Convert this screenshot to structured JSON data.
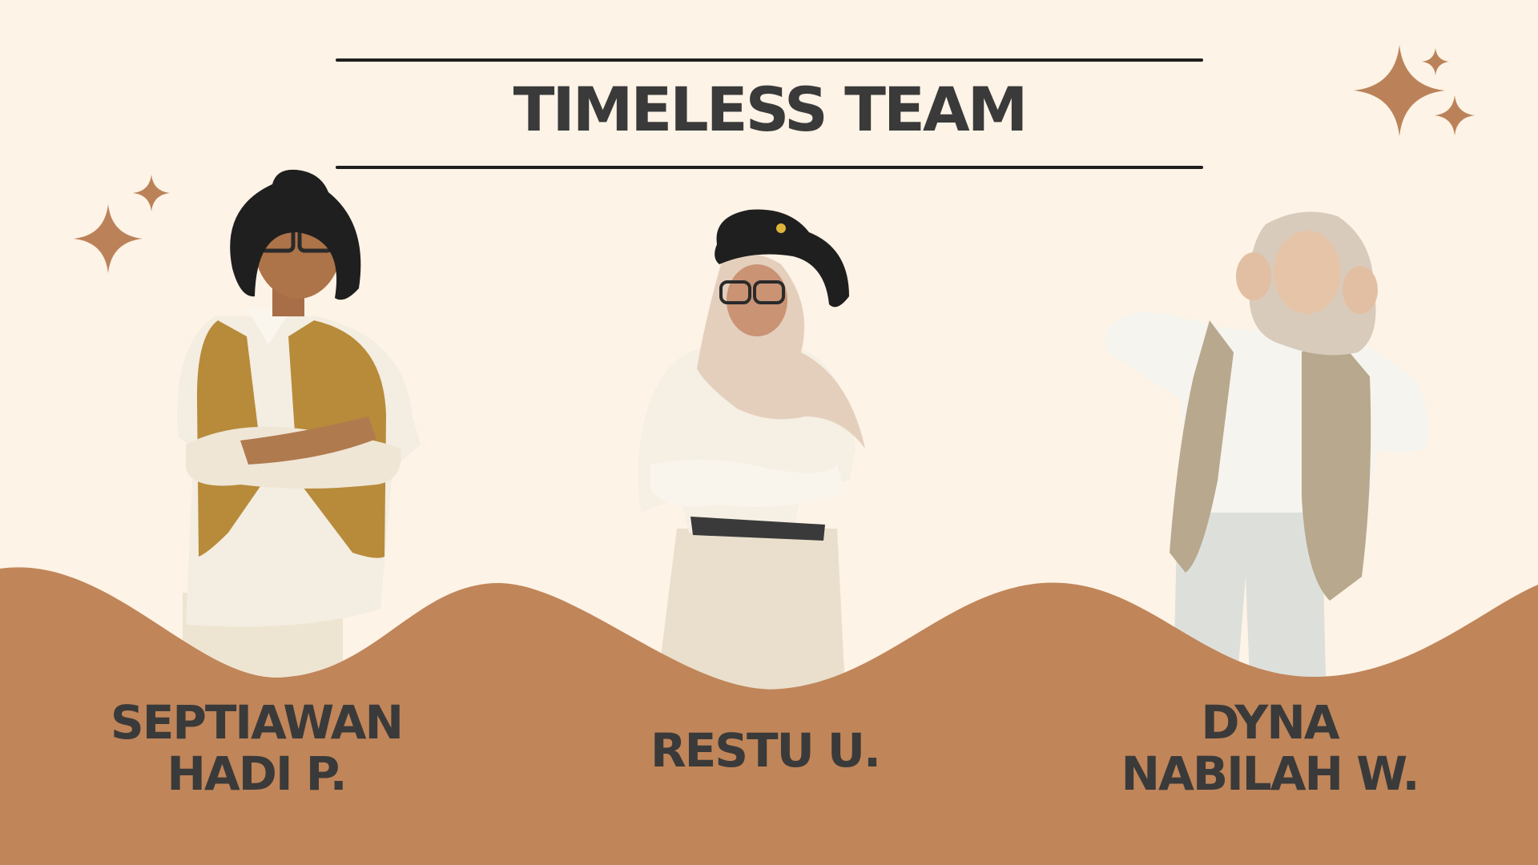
{
  "title": "TIMELESS TEAM",
  "colors": {
    "background": "#fdf3e6",
    "wave": "#c08559",
    "sparkle": "#bb8259",
    "text": "#3a3a3a",
    "rule": "#1f1f1f"
  },
  "members": [
    {
      "name_line1": "SEPTIAWAN",
      "name_line2": "HADI P."
    },
    {
      "name_line1": "RESTU U.",
      "name_line2": ""
    },
    {
      "name_line1": "DYNA",
      "name_line2": "NABILAH W."
    }
  ]
}
